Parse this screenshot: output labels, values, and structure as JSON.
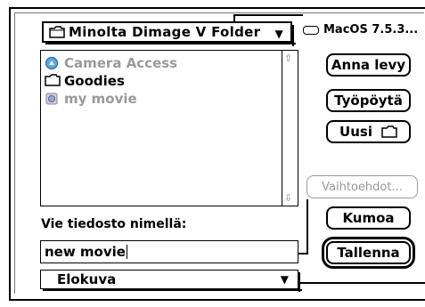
{
  "folder_popup": {
    "label": "Minolta Dimage V Folder",
    "caret": "▼",
    "icon": "folder-icon"
  },
  "volume": {
    "label": "MacOS 7.5.3...",
    "icon": "disk-icon"
  },
  "files": [
    {
      "name": "Camera Access",
      "icon": "camera-access-icon",
      "dimmed": true
    },
    {
      "name": "Goodies",
      "icon": "folder-icon",
      "dimmed": false
    },
    {
      "name": "my movie",
      "icon": "movie-file-icon",
      "dimmed": true
    }
  ],
  "buttons": {
    "eject": "Anna levy",
    "desktop": "Työpöytä",
    "new_folder": "Uusi",
    "options": "Vaihtoehdot...",
    "cancel": "Kumoa",
    "save": "Tallenna"
  },
  "save_prompt": "Vie tiedosto nimellä:",
  "filename": {
    "value": "new movie"
  },
  "format_popup": {
    "label": "Elokuva",
    "caret": "▼"
  }
}
